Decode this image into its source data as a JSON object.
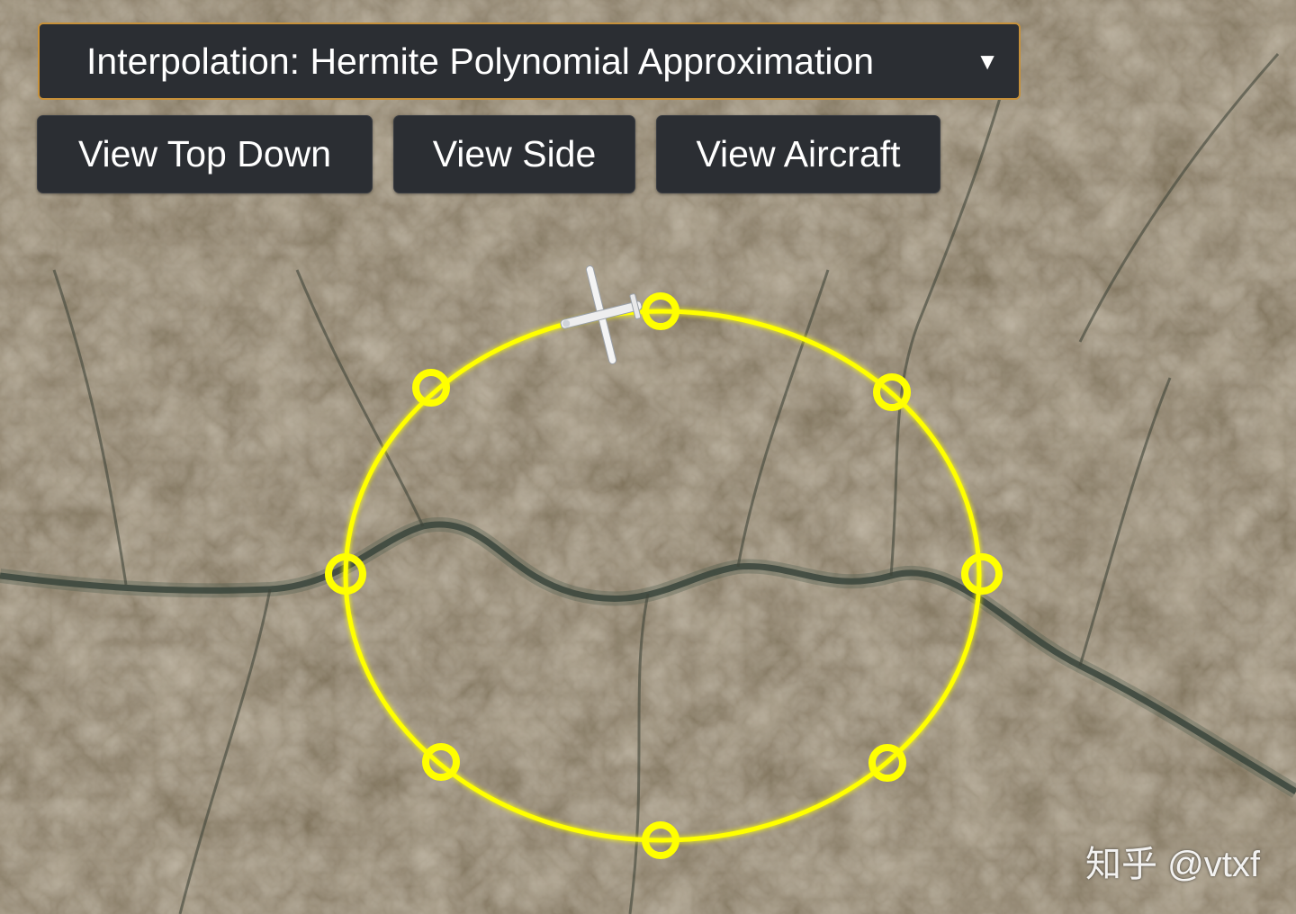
{
  "interpolation_select": {
    "label": "Interpolation: Hermite Polynomial Approximation",
    "caret": "▼"
  },
  "view_buttons": {
    "top_down": "View Top Down",
    "side": "View Side",
    "aircraft": "View Aircraft"
  },
  "watermark": "知乎 @vtxf",
  "colors": {
    "path": "#ffff00",
    "control_bg": "#2b2e33",
    "select_border": "#c7913a",
    "terrain_base": "#7b6f58"
  },
  "icons": {
    "aircraft": "aircraft-icon",
    "waypoint": "waypoint-ring-icon"
  }
}
